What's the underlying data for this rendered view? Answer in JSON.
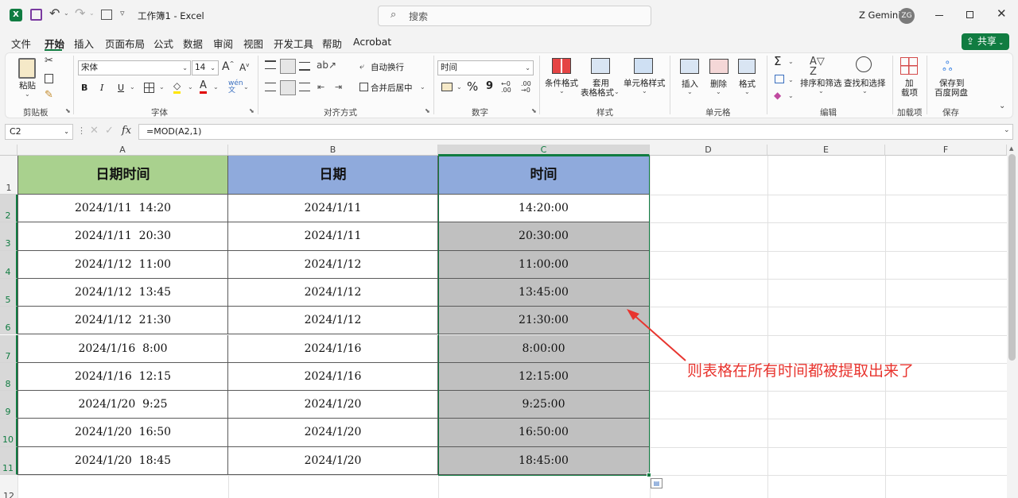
{
  "titlebar": {
    "title": "工作簿1 - Excel",
    "search_placeholder": "搜索",
    "user_name": "Z Gemini",
    "user_initials": "ZG"
  },
  "menu": {
    "items": [
      "文件",
      "开始",
      "插入",
      "页面布局",
      "公式",
      "数据",
      "审阅",
      "视图",
      "开发工具",
      "帮助",
      "Acrobat"
    ],
    "active": "开始",
    "share_label": "共享"
  },
  "ribbon": {
    "clipboard": {
      "paste": "粘贴",
      "group": "剪贴板"
    },
    "font": {
      "name": "宋体",
      "size": "14",
      "bold": "B",
      "italic": "I",
      "underline": "U",
      "group": "字体"
    },
    "alignment": {
      "wrap": "自动换行",
      "merge": "合并后居中",
      "group": "对齐方式"
    },
    "number": {
      "format": "时间",
      "percent": "%",
      "comma": "9",
      "group": "数字"
    },
    "styles": {
      "conditional": "条件格式",
      "table_format_1": "套用",
      "table_format_2": "表格格式",
      "cell_styles": "单元格样式",
      "group": "样式"
    },
    "cells": {
      "insert": "插入",
      "delete": "删除",
      "format": "格式",
      "group": "单元格"
    },
    "editing": {
      "sum": "Σ",
      "sort": "排序和筛选",
      "find": "查找和选择",
      "group": "编辑"
    },
    "addins": {
      "label_1": "加",
      "label_2": "载项",
      "group": "加载项"
    },
    "save": {
      "label_1": "保存到",
      "label_2": "百度网盘",
      "group": "保存"
    }
  },
  "formula_bar": {
    "cell_ref": "C2",
    "fx": "fx",
    "formula": "=MOD(A2,1)"
  },
  "sheet": {
    "columns": [
      "A",
      "B",
      "C",
      "D",
      "E",
      "F"
    ],
    "rows": [
      "1",
      "2",
      "3",
      "4",
      "5",
      "6",
      "7",
      "8",
      "9",
      "10",
      "11",
      "12"
    ],
    "headers": [
      "日期时间",
      "日期",
      "时间"
    ],
    "data": [
      [
        "2024/1/11  14:20",
        "2024/1/11",
        "14:20:00"
      ],
      [
        "2024/1/11  20:30",
        "2024/1/11",
        "20:30:00"
      ],
      [
        "2024/1/12  11:00",
        "2024/1/12",
        "11:00:00"
      ],
      [
        "2024/1/12  13:45",
        "2024/1/12",
        "13:45:00"
      ],
      [
        "2024/1/12  21:30",
        "2024/1/12",
        "21:30:00"
      ],
      [
        "2024/1/16  8:00",
        "2024/1/16",
        "8:00:00"
      ],
      [
        "2024/1/16  12:15",
        "2024/1/16",
        "12:15:00"
      ],
      [
        "2024/1/20  9:25",
        "2024/1/20",
        "9:25:00"
      ],
      [
        "2024/1/20  16:50",
        "2024/1/20",
        "16:50:00"
      ],
      [
        "2024/1/20  18:45",
        "2024/1/20",
        "18:45:00"
      ]
    ],
    "header_colors": [
      "#a9d18e",
      "#8faadc",
      "#8faadc"
    ],
    "selected_fill": "#c0c0c0",
    "selection_color": "#107c41"
  },
  "annotation": {
    "text": "则表格在所有时间都被提取出来了",
    "color": "#e8352f"
  }
}
